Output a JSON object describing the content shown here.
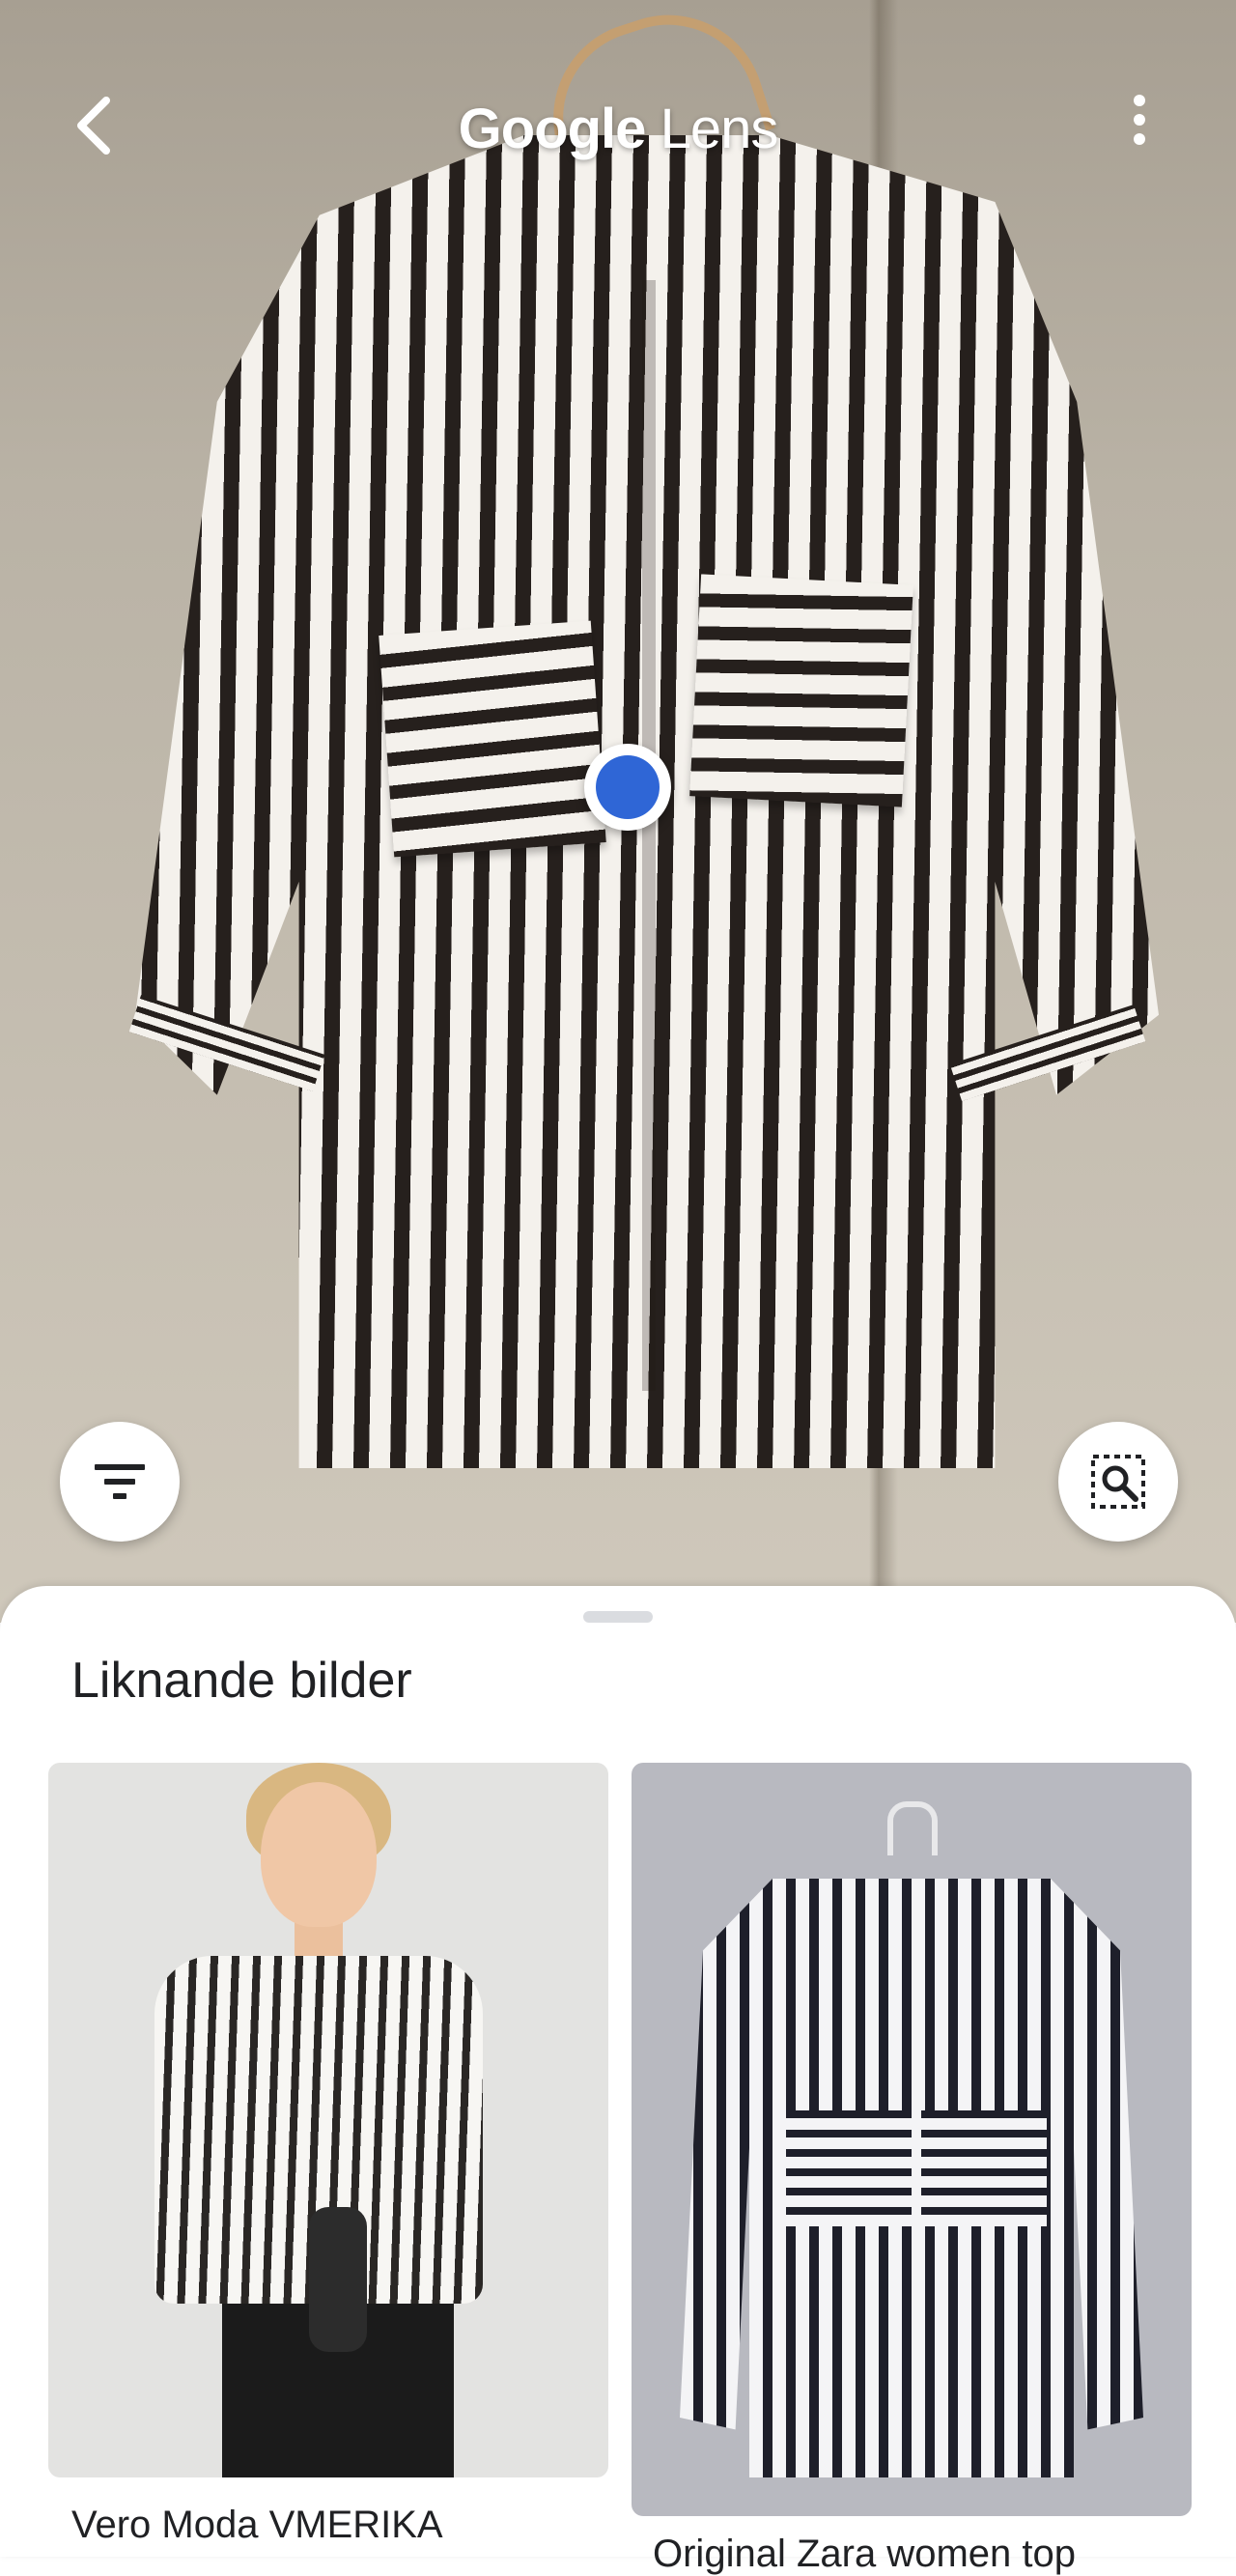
{
  "app": {
    "title_brand": "Google",
    "title_product": "Lens"
  },
  "icons": {
    "back": "arrow-back-icon",
    "menu": "more-vert-icon",
    "filter": "filter-list-icon",
    "search_region": "image-search-icon",
    "focus": "focus-dot-icon"
  },
  "colors": {
    "accent": "#2f66d6",
    "sheet_bg": "#ffffff",
    "text": "#202124"
  },
  "results": {
    "title": "Liknande bilder",
    "items": [
      {
        "caption": "Vero Moda VMERIKA"
      },
      {
        "caption": "Original Zara women top"
      }
    ]
  }
}
